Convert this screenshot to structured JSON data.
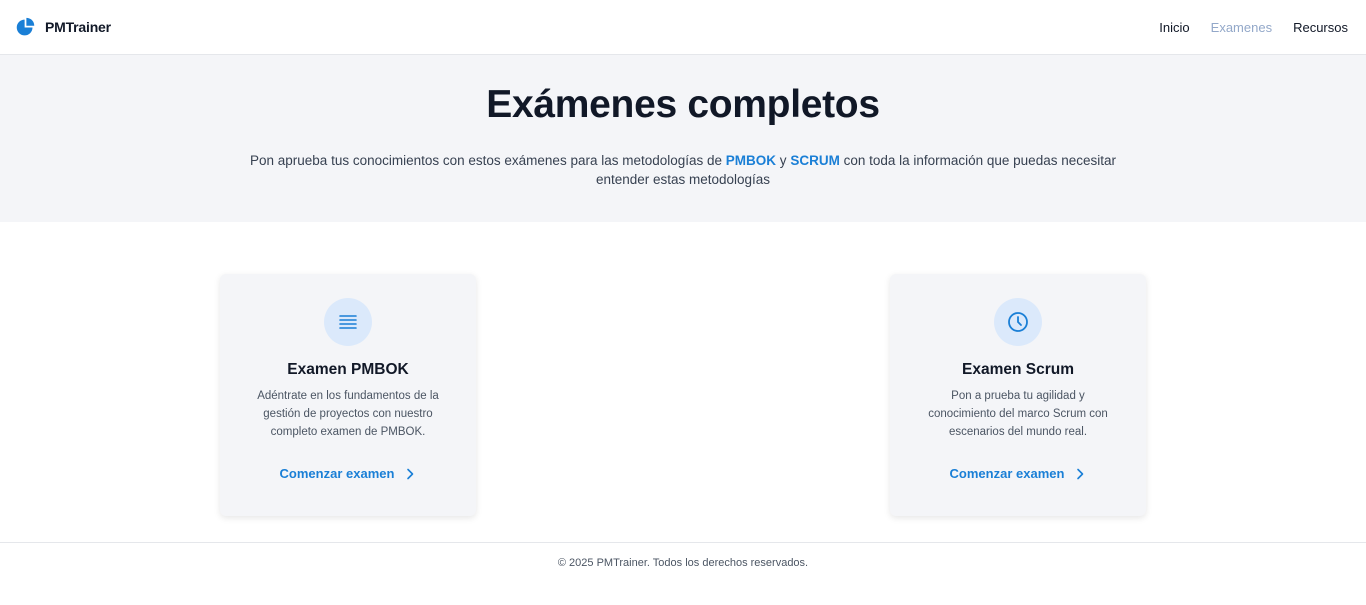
{
  "navbar": {
    "brand": "PMTrainer",
    "links": [
      {
        "label": "Inicio",
        "active": false
      },
      {
        "label": "Examenes",
        "active": true
      },
      {
        "label": "Recursos",
        "active": false
      }
    ]
  },
  "hero": {
    "title": "Exámenes completos",
    "desc_before": "Pon aprueba tus conocimientos con estos exámenes para las metodologías de ",
    "highlight_1": "PMBOK",
    "desc_between": " y ",
    "highlight_2": "SCRUM",
    "desc_after": " con toda la información que puedas necesitar entender estas metodologías"
  },
  "cards": [
    {
      "icon": "list-icon",
      "title": "Examen PMBOK",
      "description": "Adéntrate en los fundamentos de la gestión de proyectos con nuestro completo examen de PMBOK.",
      "link": "Comenzar examen"
    },
    {
      "icon": "clock-icon",
      "title": "Examen Scrum",
      "description": "Pon a prueba tu agilidad y conocimiento del marco Scrum con escenarios del mundo real.",
      "link": "Comenzar examen"
    }
  ],
  "footer": {
    "text": "© 2025 PMTrainer. Todos los derechos reservados."
  },
  "colors": {
    "accent": "#1a7fd6",
    "active_nav": "#93a8c9",
    "hero_bg": "#f4f5f8",
    "icon_bg": "#dbe9fb"
  }
}
